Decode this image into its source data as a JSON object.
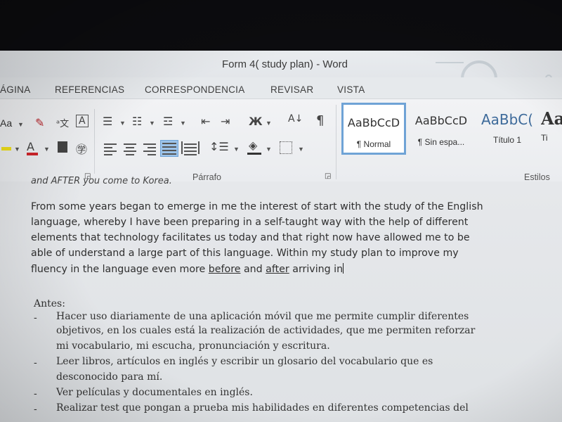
{
  "window": {
    "title": "Form 4( study plan) - Word"
  },
  "menu": {
    "tabs": [
      "ÁGINA",
      "REFERENCIAS",
      "CORRESPONDENCIA",
      "REVISAR",
      "VISTA"
    ]
  },
  "ribbon": {
    "font_group": {
      "change_case": "Aa"
    },
    "paragraph_group": {
      "label": "Párrafo"
    },
    "styles_group": {
      "label": "Estilos",
      "styles": [
        {
          "sample": "AaBbCcD",
          "name": "¶ Normal",
          "selected": true
        },
        {
          "sample": "AaBbCcD",
          "name": "¶ Sin espa...",
          "selected": false
        },
        {
          "sample": "AaBbC(",
          "name": "Título 1",
          "selected": false
        },
        {
          "sample": "Aa",
          "name": "Ti",
          "selected": false
        }
      ]
    },
    "icons": [
      "change-case-icon",
      "clear-format-icon",
      "phonetic-guide-icon",
      "char-border-icon",
      "bullets-icon",
      "numbering-icon",
      "multilevel-icon",
      "decrease-indent-icon",
      "increase-indent-icon",
      "asian-layout-icon",
      "sort-icon",
      "show-marks-icon",
      "highlight-icon",
      "font-color-icon",
      "char-shading-icon",
      "enclose-char-icon",
      "align-left-icon",
      "center-icon",
      "align-right-icon",
      "justify-icon",
      "distributed-icon",
      "line-spacing-icon",
      "shading-icon",
      "borders-icon",
      "dialog-launcher-icon"
    ],
    "colors": {
      "font_color_bar": "#d0252b",
      "highlight_bar": "#f2e21a",
      "selected_style_border": "#6fa3d6",
      "active_align_bg": "#9cc3ea"
    }
  },
  "document": {
    "partial_line": "and AFTER you come to Korea.",
    "paragraph_lines": [
      "From some years began to emerge in me the interest of start with the study of the English",
      "language, whereby I have been preparing in a self-taught way with the help of  different",
      "elements that technology facilitates us today and that right now have allowed me to be",
      "able of understand a large part of this language. Within my study plan to improve my"
    ],
    "last_line": {
      "pre": "fluency in the language even more ",
      "u1": "before",
      "mid": " and ",
      "u2": "after",
      "post": "  arriving  in"
    },
    "heading": "Antes:",
    "bullets": [
      [
        "Hacer uso diariamente de una aplicación móvil que  me permite cumplir diferentes",
        "objetivos, en los cuales está la realización de actividades, que me permiten reforzar",
        "mi vocabulario, mi escucha, pronunciación y escritura."
      ],
      [
        "Leer libros, artículos en inglés y escribir un glosario del vocabulario que es",
        "desconocido para mí."
      ],
      [
        "Ver películas y documentales en inglés."
      ],
      [
        "Realizar test que pongan a prueba mis habilidades en diferentes competencias del"
      ]
    ]
  }
}
